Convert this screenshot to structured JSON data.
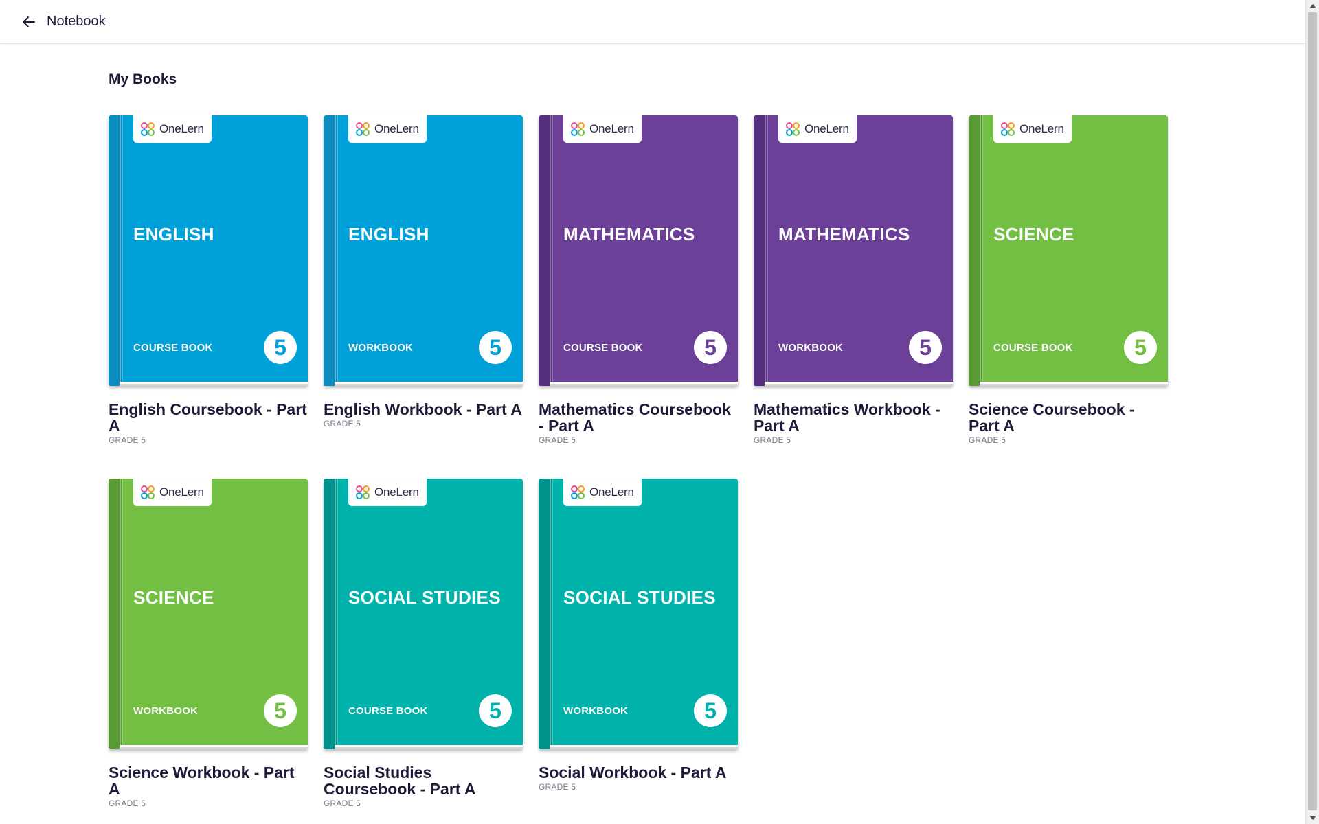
{
  "header": {
    "title": "Notebook",
    "back_icon": "arrow-left-icon"
  },
  "section": {
    "title": "My Books"
  },
  "brand": {
    "logo_text": "OneLern"
  },
  "colors": {
    "blue": "#00a0d8",
    "purple": "#6c3f98",
    "green": "#72bf44",
    "teal": "#00b2aa"
  },
  "books": [
    {
      "subject": "ENGLISH",
      "type": "COURSE BOOK",
      "grade_number": "5",
      "title": "English Coursebook - Part A",
      "grade_label": "GRADE 5",
      "color": "blue"
    },
    {
      "subject": "ENGLISH",
      "type": "WORKBOOK",
      "grade_number": "5",
      "title": "English Workbook - Part A",
      "grade_label": "GRADE 5",
      "color": "blue"
    },
    {
      "subject": "MATHEMATICS",
      "type": "COURSE BOOK",
      "grade_number": "5",
      "title": "Mathematics Coursebook - Part A",
      "grade_label": "GRADE 5",
      "color": "purple"
    },
    {
      "subject": "MATHEMATICS",
      "type": "WORKBOOK",
      "grade_number": "5",
      "title": "Mathematics Workbook - Part A",
      "grade_label": "GRADE 5",
      "color": "purple"
    },
    {
      "subject": "SCIENCE",
      "type": "COURSE BOOK",
      "grade_number": "5",
      "title": "Science Coursebook - Part A",
      "grade_label": "GRADE 5",
      "color": "green"
    },
    {
      "subject": "SCIENCE",
      "type": "WORKBOOK",
      "grade_number": "5",
      "title": "Science Workbook - Part A",
      "grade_label": "GRADE 5",
      "color": "green"
    },
    {
      "subject": "SOCIAL STUDIES",
      "type": "COURSE BOOK",
      "grade_number": "5",
      "title": "Social Studies Coursebook - Part A",
      "grade_label": "GRADE 5",
      "color": "teal"
    },
    {
      "subject": "SOCIAL STUDIES",
      "type": "WORKBOOK",
      "grade_number": "5",
      "title": "Social Workbook - Part A",
      "grade_label": "GRADE 5",
      "color": "teal"
    }
  ]
}
